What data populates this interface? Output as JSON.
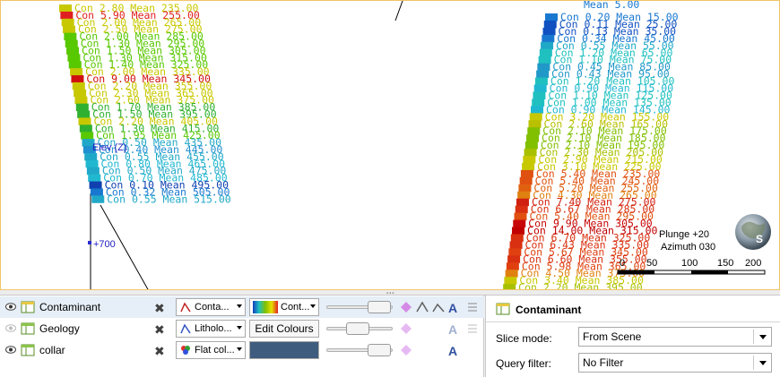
{
  "scene": {
    "elev_label": "Elev (Z)",
    "elev_value": "+700",
    "plunge": "Plunge +20",
    "azimuth": "Azimuth 030",
    "compass_letter": "S",
    "scale_ticks": [
      "0",
      "50",
      "100",
      "150",
      "200"
    ],
    "left_hole_labels": [
      {
        "text": "Con 2.80 Mean 235.00",
        "color": "#c8c800"
      },
      {
        "text": "Con 5.90 Mean 255.00",
        "color": "#e02020"
      },
      {
        "text": "Con 2.00 Mean 265.00",
        "color": "#c8c800"
      },
      {
        "text": "Con 2.50 Mean 275.00",
        "color": "#c8c800"
      },
      {
        "text": "Con 2.00 Mean 285.00",
        "color": "#58c800"
      },
      {
        "text": "Con 1.30 Mean 295.00",
        "color": "#58c800"
      },
      {
        "text": "Con 1.50 Mean 305.00",
        "color": "#58c800"
      },
      {
        "text": "Con 1.30 Mean 315.00",
        "color": "#58c800"
      },
      {
        "text": "Con 1.40 Mean 325.00",
        "color": "#58c800"
      },
      {
        "text": "Con 2.00 Mean 335.00",
        "color": "#c8c800"
      },
      {
        "text": "Con 9.00 Mean 345.00",
        "color": "#d01010"
      },
      {
        "text": "Con 2.20 Mean 355.00",
        "color": "#c8c800"
      },
      {
        "text": "Con 2.30 Mean 365.00",
        "color": "#c8c800"
      },
      {
        "text": "Con 2.60 Mean 375.00",
        "color": "#c8c800"
      },
      {
        "text": "Con 1.70 Mean 385.00",
        "color": "#30b030"
      },
      {
        "text": "Con 1.50 Mean 395.00",
        "color": "#30b030"
      },
      {
        "text": "Con 2.20 Mean 405.00",
        "color": "#c8c800"
      },
      {
        "text": "Con 1.30 Mean 415.00",
        "color": "#30b030"
      },
      {
        "text": "Con 1.95 Mean 425.00",
        "color": "#58c800"
      },
      {
        "text": "Con 0.50 Mean 435.00",
        "color": "#20a8c8"
      },
      {
        "text": "Con 0.40 Mean 445.00",
        "color": "#2090d0"
      },
      {
        "text": "Con 0.55 Mean 455.00",
        "color": "#20a8c8"
      },
      {
        "text": "Con 0.80 Mean 465.00",
        "color": "#20b8d0"
      },
      {
        "text": "Con 0.50 Mean 475.00",
        "color": "#20a8c8"
      },
      {
        "text": "Con 0.70 Mean 485.00",
        "color": "#20b8d0"
      },
      {
        "text": "Con 0.10 Mean 495.00",
        "color": "#1040b0"
      },
      {
        "text": "Con 0.32 Mean 505.00",
        "color": "#1878d0"
      },
      {
        "text": "Con 0.55 Mean 515.00",
        "color": "#20a8c8"
      }
    ],
    "right_hole_labels": [
      {
        "text": "Con 0.20 Mean 15.00",
        "color": "#1878d0"
      },
      {
        "text": "Con 0.11 Mean 25.00",
        "color": "#1050c0"
      },
      {
        "text": "Con 0.13 Mean 35.00",
        "color": "#1050c0"
      },
      {
        "text": "Con 0.34 Mean 45.00",
        "color": "#1878d0"
      },
      {
        "text": "Con 0.55 Mean 55.00",
        "color": "#20a8c8"
      },
      {
        "text": "Con 1.20 Mean 65.00",
        "color": "#20c0c0"
      },
      {
        "text": "Con 1.10 Mean 75.00",
        "color": "#20c0c0"
      },
      {
        "text": "Con 0.45 Mean 85.00",
        "color": "#2098c8"
      },
      {
        "text": "Con 0.43 Mean 95.00",
        "color": "#2098c8"
      },
      {
        "text": "Con 1.20 Mean 105.00",
        "color": "#20c0c0"
      },
      {
        "text": "Con 0.90 Mean 115.00",
        "color": "#20b8d0"
      },
      {
        "text": "Con 1.10 Mean 125.00",
        "color": "#20c0c0"
      },
      {
        "text": "Con 1.00 Mean 135.00",
        "color": "#20c0c0"
      },
      {
        "text": "Con 0.90 Mean 145.00",
        "color": "#20b8d0"
      },
      {
        "text": "Con 3.20 Mean 155.00",
        "color": "#c8c800"
      },
      {
        "text": "Con 2.60 Mean 165.00",
        "color": "#b8c000"
      },
      {
        "text": "Con 2.10 Mean 175.00",
        "color": "#80c000"
      },
      {
        "text": "Con 2.10 Mean 185.00",
        "color": "#80c000"
      },
      {
        "text": "Con 2.10 Mean 195.00",
        "color": "#80c000"
      },
      {
        "text": "Con 2.30 Mean 205.00",
        "color": "#a8c000"
      },
      {
        "text": "Con 2.90 Mean 215.00",
        "color": "#c8c800"
      },
      {
        "text": "Con 3.10 Mean 225.00",
        "color": "#c8c800"
      },
      {
        "text": "Con 5.40 Mean 235.00",
        "color": "#e05010"
      },
      {
        "text": "Con 5.40 Mean 245.00",
        "color": "#e05010"
      },
      {
        "text": "Con 5.20 Mean 255.00",
        "color": "#e06010"
      },
      {
        "text": "Con 4.30 Mean 265.00",
        "color": "#e08010"
      },
      {
        "text": "Con 7.40 Mean 275.00",
        "color": "#d02010"
      },
      {
        "text": "Con 6.67 Mean 285.00",
        "color": "#d83010"
      },
      {
        "text": "Con 5.40 Mean 295.00",
        "color": "#e05010"
      },
      {
        "text": "Con 9.90 Mean 305.00",
        "color": "#c80808"
      },
      {
        "text": "Con 14.00 Mean 315.00",
        "color": "#c00000"
      },
      {
        "text": "Con 6.70 Mean 325.00",
        "color": "#d83010"
      },
      {
        "text": "Con 6.43 Mean 335.00",
        "color": "#d83010"
      },
      {
        "text": "Con 5.67 Mean 345.00",
        "color": "#e04010"
      },
      {
        "text": "Con 6.60 Mean 355.00",
        "color": "#d83010"
      },
      {
        "text": "Con 5.98 Mean 365.00",
        "color": "#e04010"
      },
      {
        "text": "Con 4.50 Mean 375.00",
        "color": "#e08010"
      },
      {
        "text": "Con 3.40 Mean 385.00",
        "color": "#c8c800"
      },
      {
        "text": "Con 2.20 Mean 395.00",
        "color": "#a8c000"
      }
    ],
    "right_top_label": "Mean 5.00"
  },
  "layers": [
    {
      "name": "Contaminant",
      "visible": true,
      "style": "Conta...",
      "colour": "Cont...",
      "icon_color": "#e8c840"
    },
    {
      "name": "Geology",
      "visible": false,
      "style": "Litholo...",
      "colour": "Edit Colours",
      "icon_color": "#8bc34a"
    },
    {
      "name": "collar",
      "visible": true,
      "style": "Flat col...",
      "colour_hex": "#3e5d7e",
      "icon_color": "#8bc34a"
    }
  ],
  "props": {
    "title": "Contaminant",
    "slice_mode_label": "Slice mode:",
    "slice_mode_value": "From Scene",
    "query_filter_label": "Query filter:",
    "query_filter_value": "No Filter"
  }
}
